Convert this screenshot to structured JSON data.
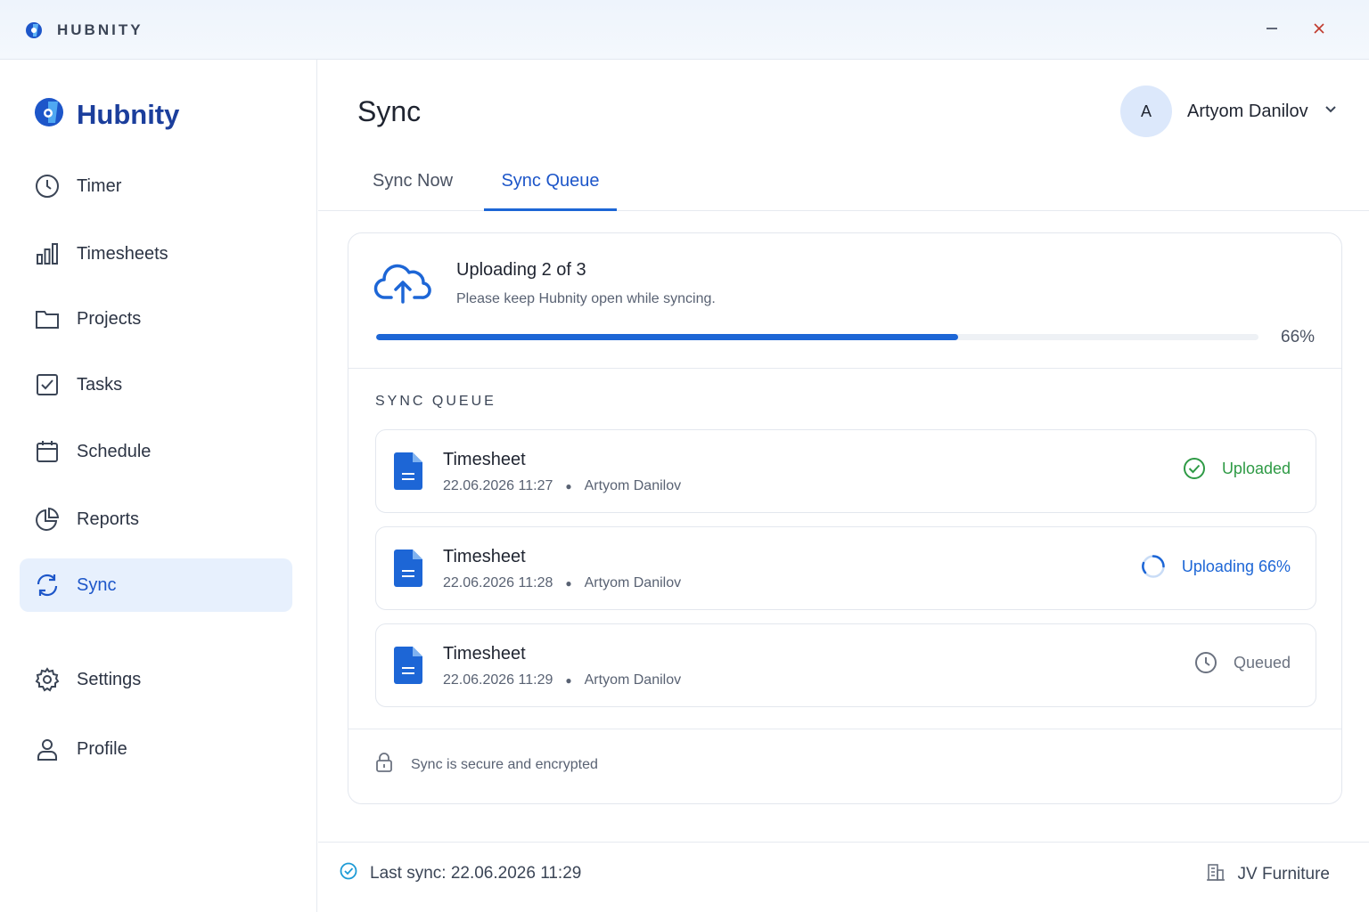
{
  "titlebar": {
    "app_name": "HUBNITY",
    "logo_icon": "hubnity-logo-icon",
    "minimize_icon": "minimize-icon",
    "close_icon": "close-icon"
  },
  "sidebar": {
    "brand": "Hubnity",
    "items": [
      {
        "label": "Timer",
        "icon": "clock-icon"
      },
      {
        "label": "Timesheets",
        "icon": "bar-chart-icon"
      },
      {
        "label": "Projects",
        "icon": "folder-icon"
      },
      {
        "label": "Tasks",
        "icon": "checkbox-icon"
      },
      {
        "label": "Schedule",
        "icon": "calendar-icon"
      },
      {
        "label": "Reports",
        "icon": "pie-chart-icon"
      },
      {
        "label": "Sync",
        "icon": "sync-icon",
        "active": true
      },
      {
        "label": "Settings",
        "icon": "gear-icon"
      },
      {
        "label": "Profile",
        "icon": "user-icon"
      }
    ]
  },
  "header": {
    "title": "Sync",
    "user": {
      "initial": "A",
      "name": "Artyom Danilov"
    }
  },
  "tabs": [
    {
      "label": "Sync Now",
      "active": false
    },
    {
      "label": "Sync Queue",
      "active": true
    }
  ],
  "upload": {
    "title": "Uploading 2 of 3",
    "subtitle": "Please keep Hubnity open while syncing.",
    "progress": 0.66,
    "progress_label": "66%"
  },
  "queue": {
    "heading": "SYNC QUEUE",
    "items": [
      {
        "title": "Timesheet",
        "datetime": "22.06.2026 11:27",
        "author": "Artyom Danilov",
        "status": "Uploaded",
        "status_icon": "check-circle-icon"
      },
      {
        "title": "Timesheet",
        "datetime": "22.06.2026 11:28",
        "author": "Artyom Danilov",
        "status": "Uploading 66%",
        "status_icon": "spinner-icon"
      },
      {
        "title": "Timesheet",
        "datetime": "22.06.2026 11:29",
        "author": "Artyom Danilov",
        "status": "Queued",
        "status_icon": "clock-icon"
      }
    ]
  },
  "secure_note": "Sync is secure and encrypted",
  "footer": {
    "last_sync": "Last sync: 22.06.2026 11:29",
    "company": "JV Furniture"
  },
  "colors": {
    "accent": "#1d66d6",
    "success": "#2e9a45",
    "muted": "#6b7280",
    "active_nav_bg": "#e7f0fd"
  }
}
